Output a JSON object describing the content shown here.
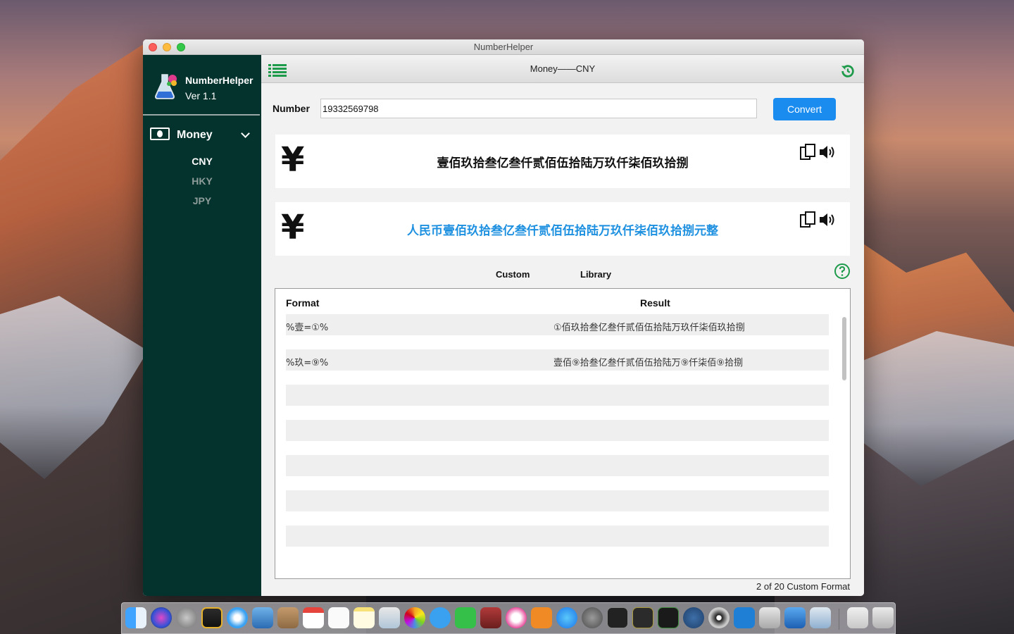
{
  "window": {
    "title": "NumberHelper"
  },
  "sidebar": {
    "app_name": "NumberHelper",
    "version": "Ver 1.1",
    "section_label": "Money",
    "items": [
      {
        "label": "CNY",
        "active": true
      },
      {
        "label": "HKY",
        "active": false
      },
      {
        "label": "JPY",
        "active": false
      }
    ]
  },
  "toolbar": {
    "title": "Money——CNY",
    "accent": "#1e9a4b"
  },
  "form": {
    "number_label": "Number",
    "number_value": "19332569798",
    "convert_label": "Convert",
    "button_color": "#1a8cf0"
  },
  "results": [
    {
      "symbol": "¥",
      "text": "壹佰玖拾叁亿叁仟贰佰伍拾陆万玖仟柒佰玖拾捌",
      "color": "#111111"
    },
    {
      "symbol": "¥",
      "text": "人民币壹佰玖拾叁亿叁仟贰佰伍拾陆万玖仟柒佰玖拾捌元整",
      "color": "#1e90e0"
    }
  ],
  "tabs": {
    "custom": "Custom",
    "library": "Library"
  },
  "table": {
    "headers": {
      "format": "Format",
      "result": "Result"
    },
    "rows": [
      {
        "format": "%壹=①%",
        "result": "①佰玖拾叁亿叁仟贰佰伍拾陆万玖仟柒佰玖拾捌"
      },
      {
        "format": "%玖=⑨%",
        "result": "壹佰⑨拾叁亿叁仟贰佰伍拾陆万⑨仟柒佰⑨拾捌"
      }
    ]
  },
  "footer": {
    "count_text": "2 of 20 Custom Format"
  },
  "dock": {
    "icons": [
      "finder-icon",
      "siri-icon",
      "launchpad-icon",
      "mission-control-icon",
      "safari-icon",
      "mail-icon",
      "contacts-icon",
      "calendar-icon",
      "reminders-icon",
      "notes-icon",
      "preview-icon",
      "photos-icon",
      "messages-icon",
      "facetime-icon",
      "photo-booth-icon",
      "itunes-icon",
      "ibooks-icon",
      "app-store-icon",
      "system-preferences-icon",
      "terminal-icon",
      "console-icon",
      "activity-monitor-icon",
      "sourcetree-icon",
      "dvd-player-icon",
      "vscode-icon",
      "script-editor-icon",
      "xcode-icon",
      "numberhelper-icon",
      "downloads-icon",
      "trash-icon"
    ]
  }
}
